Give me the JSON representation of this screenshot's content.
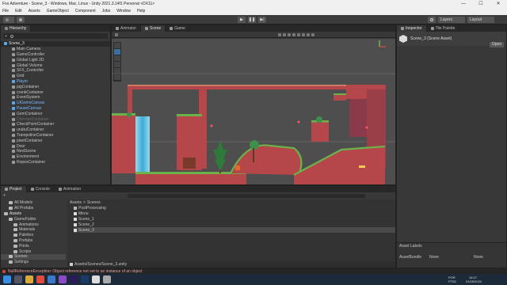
{
  "window": {
    "title": "Fox Adventure - Scene_3 - Windows, Mac, Linux - Unity 2021.3.14f1 Personal <DX11>",
    "controls": [
      "—",
      "☐",
      "✕"
    ]
  },
  "menu": [
    "File",
    "Edit",
    "Assets",
    "GameObject",
    "Component",
    "Jobs",
    "Window",
    "Help"
  ],
  "toolbar": {
    "play": "▶",
    "pause": "❚❚",
    "step": "▶|",
    "layers_label": "Layers",
    "layout_label": "Layout"
  },
  "hierarchy": {
    "tab": "Hierarchy",
    "items": [
      {
        "label": "Scene_3",
        "depth": 0,
        "type": "scene"
      },
      {
        "label": "Main Camera",
        "depth": 1,
        "type": "obj"
      },
      {
        "label": "GameController",
        "depth": 1,
        "type": "obj"
      },
      {
        "label": "Global Light 2D",
        "depth": 1,
        "type": "obj"
      },
      {
        "label": "Global Volume",
        "depth": 1,
        "type": "obj"
      },
      {
        "label": "SFX_Controller",
        "depth": 1,
        "type": "obj"
      },
      {
        "label": "Grid",
        "depth": 1,
        "type": "obj"
      },
      {
        "label": "Player",
        "depth": 1,
        "type": "prefab"
      },
      {
        "label": "pigContainer",
        "depth": 1,
        "type": "obj"
      },
      {
        "label": "crankContainer",
        "depth": 1,
        "type": "obj"
      },
      {
        "label": "EventSystem",
        "depth": 1,
        "type": "obj"
      },
      {
        "label": "UIGemsCanvas",
        "depth": 1,
        "type": "prefab"
      },
      {
        "label": "PauseCanvas",
        "depth": 1,
        "type": "prefab"
      },
      {
        "label": "GemContainer",
        "depth": 1,
        "type": "obj"
      },
      {
        "label": "CherriesContainer",
        "depth": 1,
        "type": "dim"
      },
      {
        "label": "CheckPointContainer",
        "depth": 1,
        "type": "obj"
      },
      {
        "label": "urubuContainer",
        "depth": 1,
        "type": "obj"
      },
      {
        "label": "TrampolineContainer",
        "depth": 1,
        "type": "obj"
      },
      {
        "label": "plantContainer",
        "depth": 1,
        "type": "obj"
      },
      {
        "label": "Door",
        "depth": 1,
        "type": "obj"
      },
      {
        "label": "NextScene",
        "depth": 1,
        "type": "obj"
      },
      {
        "label": "Environment",
        "depth": 1,
        "type": "obj"
      },
      {
        "label": "RopesContainer",
        "depth": 1,
        "type": "obj"
      }
    ]
  },
  "scene_tabs": [
    "Animator",
    "Scene",
    "Game"
  ],
  "inspector": {
    "tabs": [
      "Inspector",
      "Tile Palette"
    ],
    "asset_title": "Scene_3 (Scene Asset)",
    "open_button": "Open",
    "asset_labels": "Asset Labels",
    "asset_bundle_label": "AssetBundle",
    "asset_bundle_value": "None",
    "asset_bundle_variant": "None"
  },
  "project": {
    "tabs": [
      "Project",
      "Console",
      "Animation"
    ],
    "tree": [
      {
        "label": "All Models",
        "depth": 1
      },
      {
        "label": "All Prefabs",
        "depth": 1
      },
      {
        "label": "Assets",
        "depth": 0
      },
      {
        "label": "GameFolder",
        "depth": 1
      },
      {
        "label": "Animations",
        "depth": 2
      },
      {
        "label": "Materials",
        "depth": 2
      },
      {
        "label": "Palettes",
        "depth": 2
      },
      {
        "label": "Prefabs",
        "depth": 2
      },
      {
        "label": "Prints",
        "depth": 2
      },
      {
        "label": "Scripts",
        "depth": 2
      },
      {
        "label": "Scenes",
        "depth": 1
      },
      {
        "label": "Settings",
        "depth": 1
      }
    ],
    "breadcrumb": [
      "Assets",
      "Scenes"
    ],
    "files": [
      {
        "label": "PostProcessing",
        "kind": "folder"
      },
      {
        "label": "Menu",
        "kind": "scene"
      },
      {
        "label": "Scene_1",
        "kind": "scene"
      },
      {
        "label": "Scene_2",
        "kind": "scene"
      },
      {
        "label": "Scene_3",
        "kind": "scene"
      }
    ],
    "path": "Assets/Scenes/Scene_3.unity"
  },
  "status": {
    "message": "NullReferenceException: Object reference not set to an instance of an object"
  },
  "taskbar": {
    "lang": "POR",
    "lang2": "PTB2",
    "time": "18:27",
    "date": "01/05/2024"
  },
  "colors": {
    "accent_select": "#2c5d87",
    "prefab_text": "#7cb8ff",
    "error": "#e04040",
    "sky": "#4e4e4e",
    "brick": "#b5474a"
  }
}
